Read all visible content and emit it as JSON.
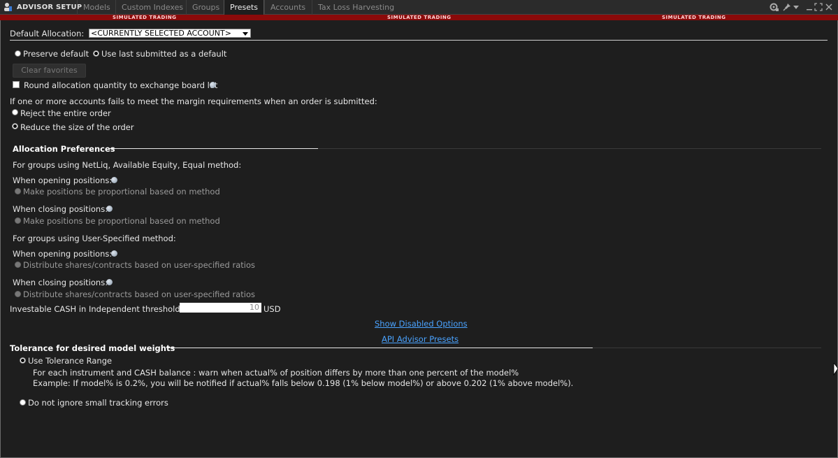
{
  "titlebar": {
    "app_title": "ADVISOR SETUP",
    "tabs": [
      {
        "label": "Models",
        "active": false
      },
      {
        "label": "Custom Indexes",
        "active": false
      },
      {
        "label": "Groups",
        "active": false
      },
      {
        "label": "Presets",
        "active": true
      },
      {
        "label": "Accounts",
        "active": false
      },
      {
        "label": "Tax Loss Harvesting",
        "active": false
      }
    ],
    "icons": [
      "link-icon",
      "pin-icon",
      "dropdown-icon",
      "minimize-icon",
      "maximize-icon",
      "close-icon"
    ]
  },
  "banner": {
    "text": "SIMULATED TRADING",
    "color": "#8b0a0a"
  },
  "default_allocation": {
    "label": "Default Allocation:",
    "selected": "<CURRENTLY SELECTED ACCOUNT>"
  },
  "default_options": {
    "preserve": "Preserve default",
    "use_last": "Use last submitted as a default"
  },
  "clear_favorites": "Clear favorites",
  "round_allocation": "Round allocation quantity to exchange board lot",
  "margin": {
    "question": "If one or more accounts fails to meet the margin requirements when an order is submitted:",
    "reject": "Reject the entire order",
    "reduce": "Reduce the size of the order"
  },
  "allocation_prefs": {
    "header": "Allocation Preferences",
    "netliq_group": "For groups using NetLiq, Available Equity, Equal method:",
    "opening": "When opening positions:",
    "closing": "When closing positions:",
    "proportional": "Make positions be proportional based on method",
    "user_group": "For groups using User-Specified method:",
    "distribute": "Distribute shares/contracts based on user-specified ratios"
  },
  "cash_threshold": {
    "label": "Investable CASH in Independent threshold:",
    "value": "10",
    "unit": "USD"
  },
  "links": {
    "show_disabled": "Show Disabled Options",
    "api_presets": "API Advisor Presets"
  },
  "tolerance": {
    "header": "Tolerance for desired model weights",
    "use_range": "Use Tolerance Range",
    "desc1": "For each instrument and CASH balance : warn when actual% of position differs by more than one percent of the model%",
    "desc2": "Example: If model% is 0.2%, you will be notified if actual% falls below 0.198 (1% below model%) or above 0.202 (1% above model%).",
    "no_ignore": "Do not ignore small tracking errors"
  }
}
